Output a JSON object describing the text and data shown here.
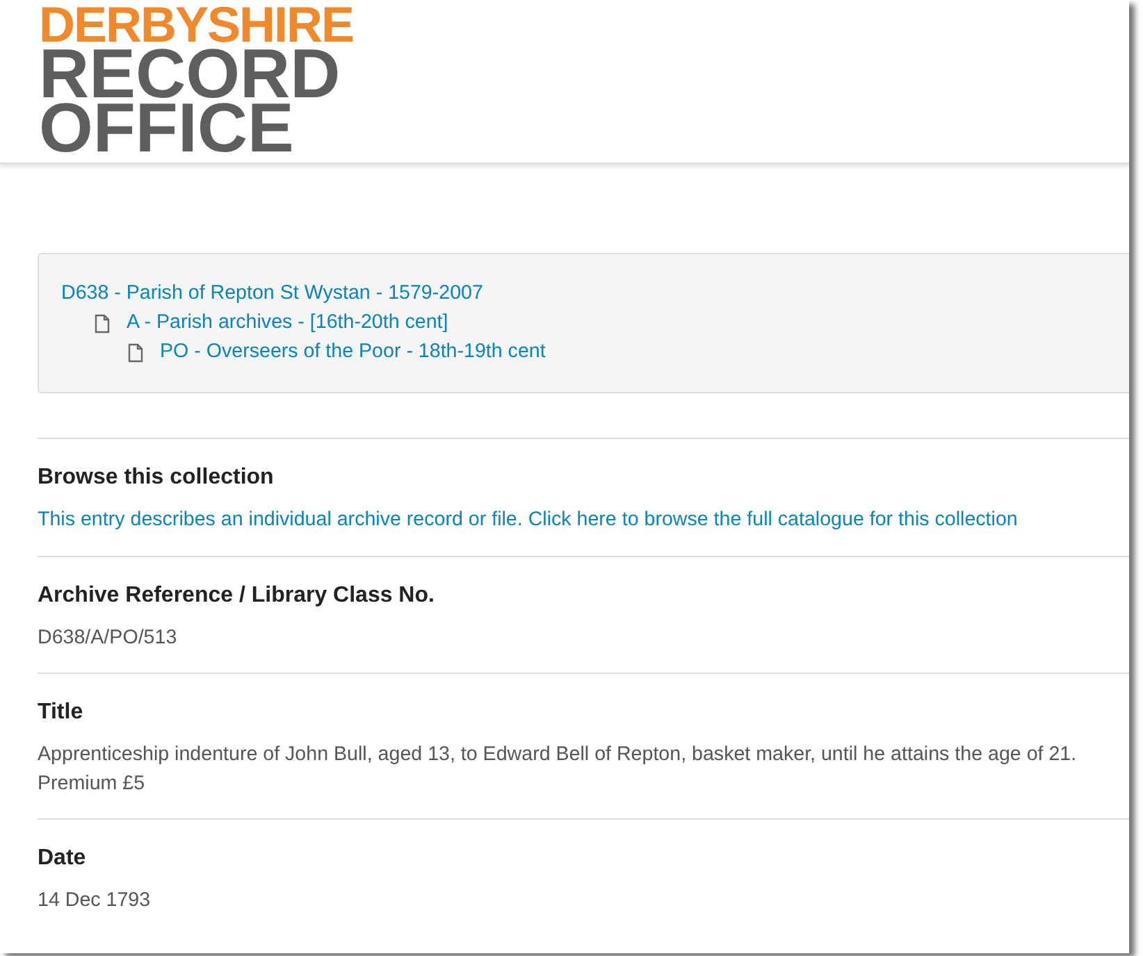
{
  "logo": {
    "lines": [
      "DERBYSHIRE",
      "RECORD",
      "OFFICE"
    ]
  },
  "breadcrumb": [
    {
      "text": "D638 - Parish of Repton St Wystan - 1579-2007",
      "children": [
        {
          "text": "A - Parish archives - [16th-20th cent]",
          "children": [
            {
              "text": "PO - Overseers of the Poor - 18th-19th cent"
            }
          ]
        }
      ]
    }
  ],
  "sections": [
    {
      "heading": "Browse this collection",
      "kind": "link",
      "body": "This entry describes an individual archive record or file. Click here to browse the full catalogue for this collection"
    },
    {
      "heading": "Archive Reference / Library Class No.",
      "kind": "text",
      "body": "D638/A/PO/513"
    },
    {
      "heading": "Title",
      "kind": "text",
      "body": "Apprenticeship indenture of John Bull, aged 13, to Edward Bell of Repton, basket maker, until he attains the age of 21. Premium £5"
    },
    {
      "heading": "Date",
      "kind": "text",
      "body": "14 Dec 1793"
    }
  ]
}
